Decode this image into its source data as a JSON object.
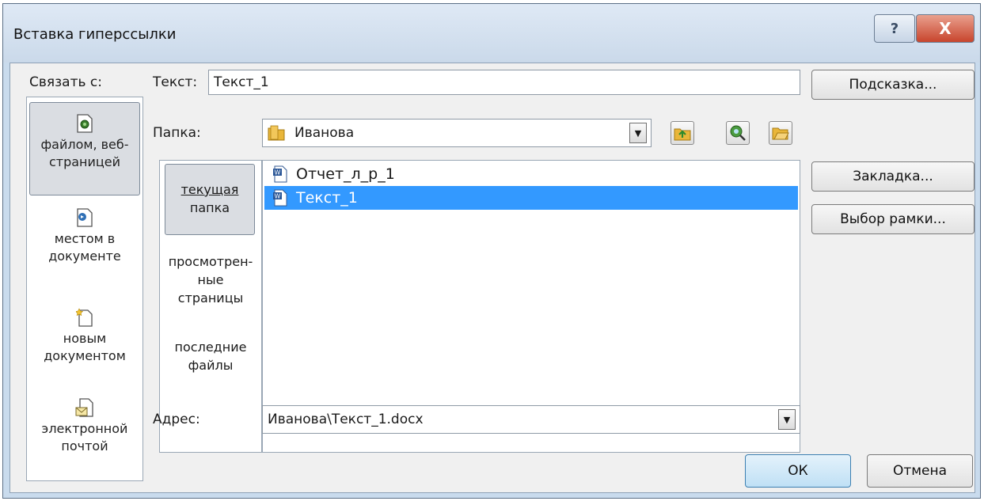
{
  "window": {
    "title": "Вставка гиперссылки",
    "help_glyph": "?",
    "close_glyph": "X"
  },
  "link_to": {
    "label": "Связать с:",
    "items": [
      {
        "line1": "файлом, веб-",
        "line2": "страницей",
        "icon": "web-page-icon",
        "selected": true
      },
      {
        "line1": "местом в",
        "line2": "документе",
        "icon": "place-in-document-icon",
        "selected": false
      },
      {
        "line1": "новым",
        "line2": "документом",
        "icon": "new-document-icon",
        "selected": false
      },
      {
        "line1": "электронной",
        "line2": "почтой",
        "icon": "email-icon",
        "selected": false
      }
    ]
  },
  "text_field": {
    "label": "Текст:",
    "value": "Текст_1"
  },
  "tooltip_button": "Подсказка...",
  "folder": {
    "label": "Папка:",
    "value": "Иванова"
  },
  "subnav": {
    "current_folder_l1": "текущая",
    "current_folder_l2": "папка",
    "browsed_l1": "просмотрен-",
    "browsed_l2": "ные",
    "browsed_l3": "страницы",
    "recent_l1": "последние",
    "recent_l2": "файлы"
  },
  "files": [
    {
      "name": "Отчет_л_р_1",
      "selected": false
    },
    {
      "name": "Текст_1",
      "selected": true
    }
  ],
  "bookmark_button": "Закладка...",
  "frame_button": "Выбор рамки...",
  "address": {
    "label": "Адрес:",
    "value": "Иванова\\Текст_1.docx"
  },
  "ok_button": "ОК",
  "cancel_button": "Отмена",
  "colors": {
    "selection": "#3399ff",
    "frame": "#c9dbed",
    "close": "#c8452d"
  }
}
